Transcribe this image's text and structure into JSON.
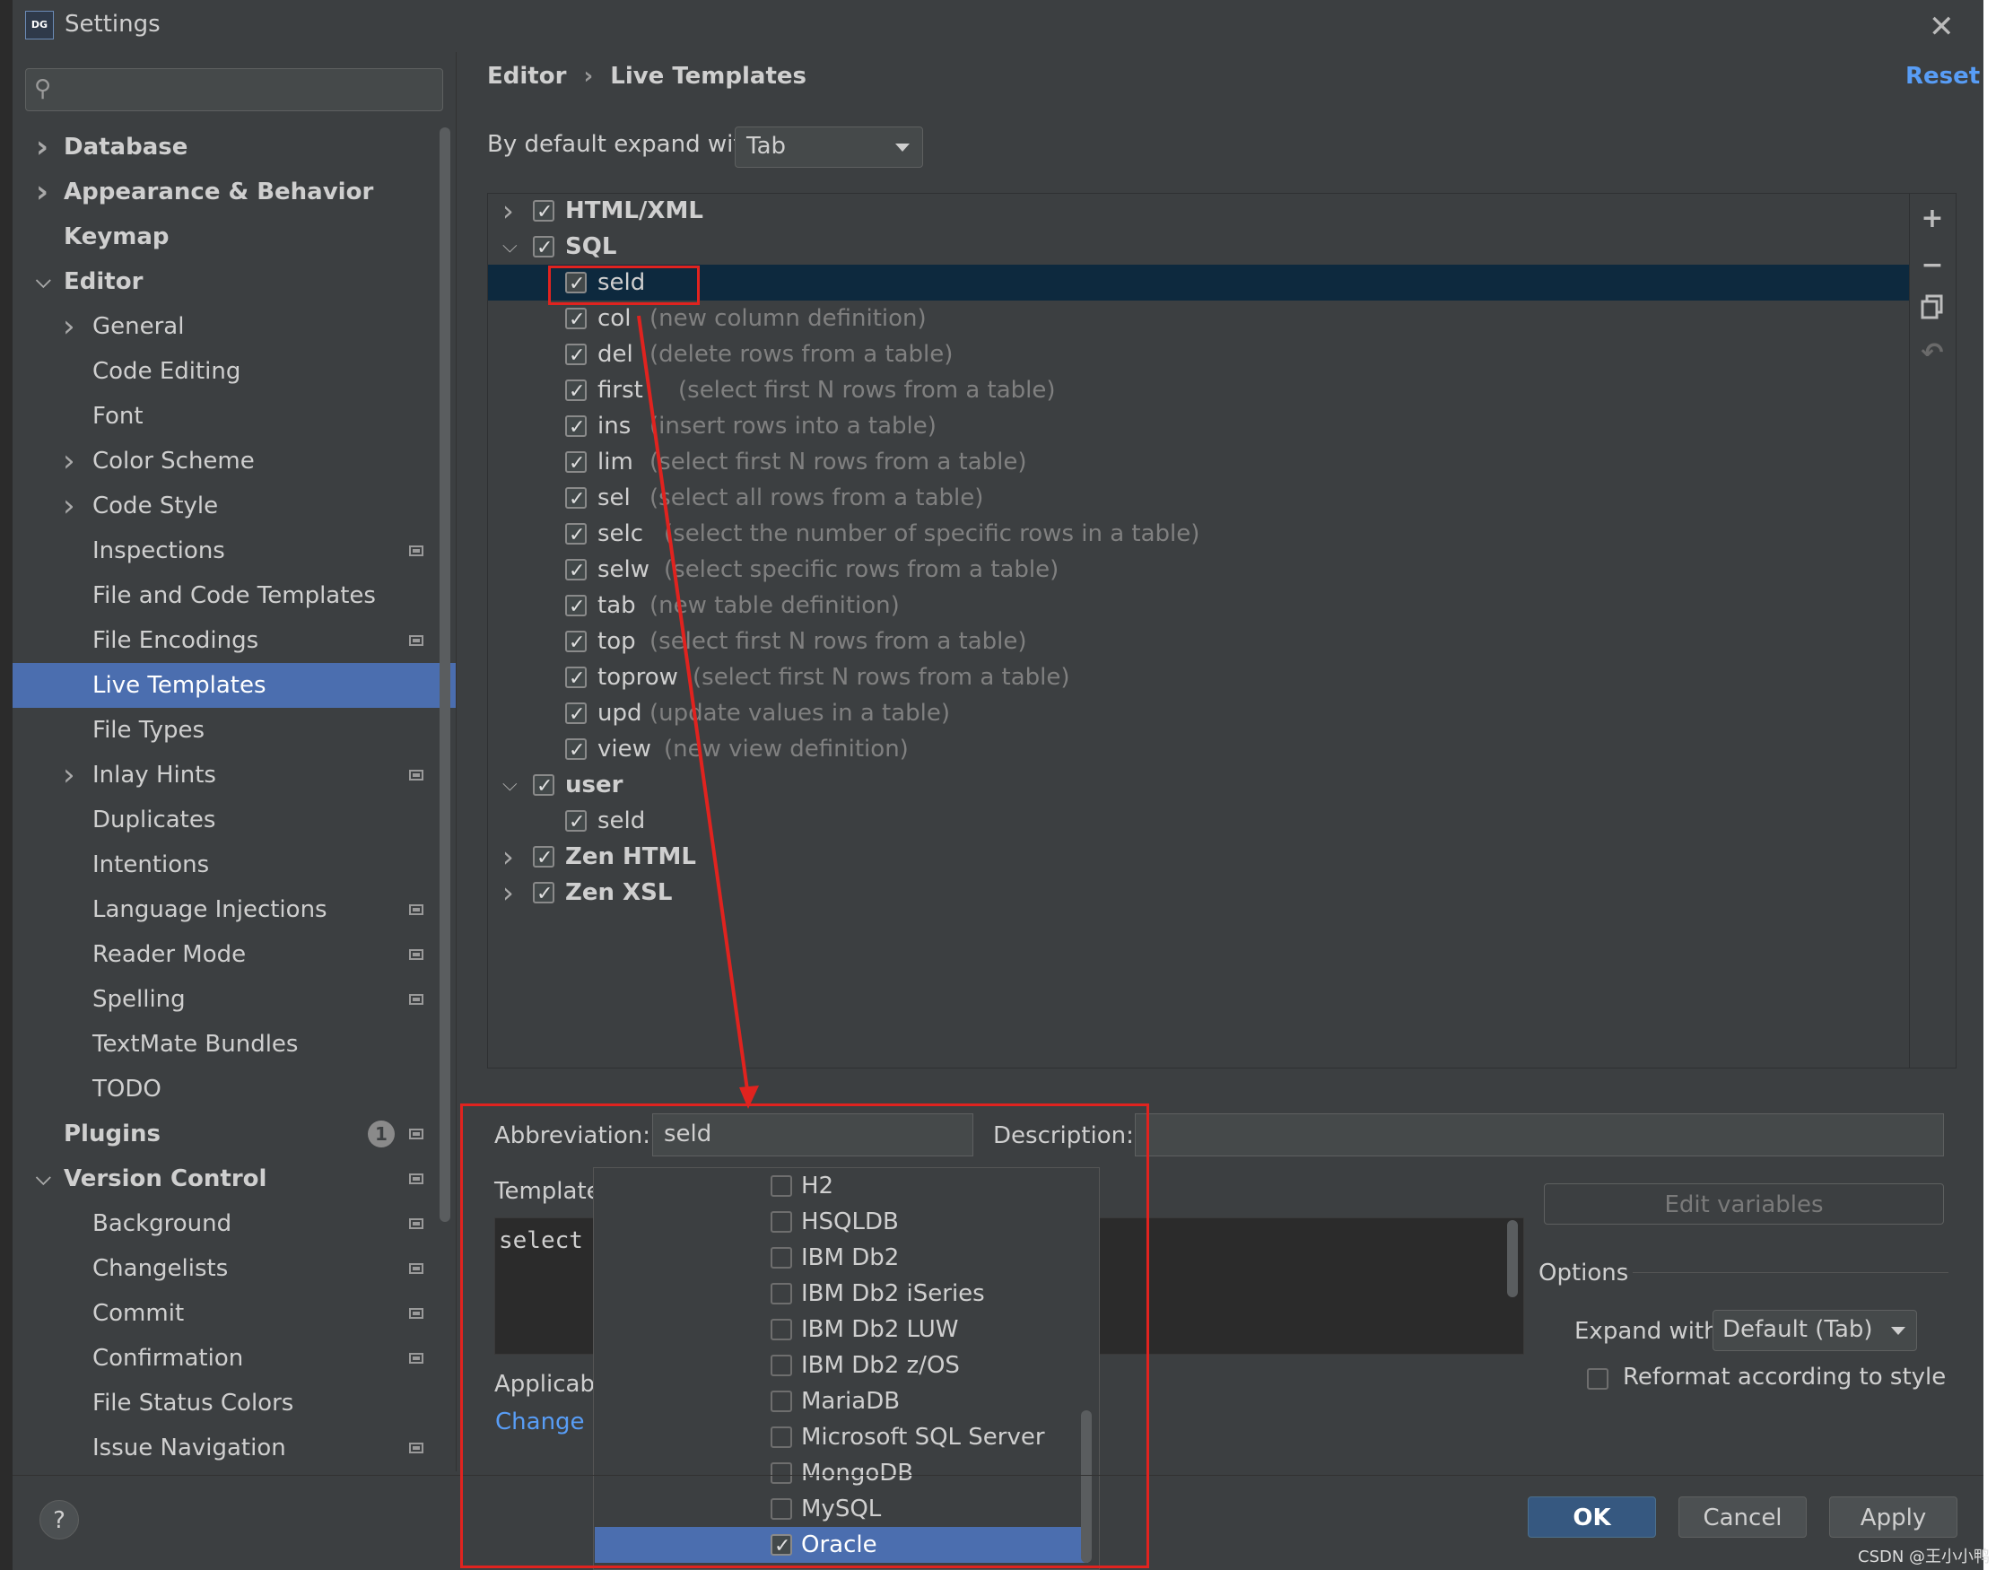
{
  "window": {
    "title": "Settings",
    "app_icon": "DG"
  },
  "search": {
    "placeholder": ""
  },
  "sidebar": [
    {
      "label": "Database",
      "bold": true,
      "chevron": "right",
      "indent": 0
    },
    {
      "label": "Appearance & Behavior",
      "bold": true,
      "chevron": "right",
      "indent": 0
    },
    {
      "label": "Keymap",
      "bold": true,
      "chevron": "",
      "indent": 0
    },
    {
      "label": "Editor",
      "bold": true,
      "chevron": "down",
      "indent": 0
    },
    {
      "label": "General",
      "bold": false,
      "chevron": "right",
      "indent": 1
    },
    {
      "label": "Code Editing",
      "bold": false,
      "chevron": "",
      "indent": 1
    },
    {
      "label": "Font",
      "bold": false,
      "chevron": "",
      "indent": 1
    },
    {
      "label": "Color Scheme",
      "bold": false,
      "chevron": "right",
      "indent": 1
    },
    {
      "label": "Code Style",
      "bold": false,
      "chevron": "right",
      "indent": 1
    },
    {
      "label": "Inspections",
      "bold": false,
      "chevron": "",
      "indent": 1,
      "icon": "project-scope-icon"
    },
    {
      "label": "File and Code Templates",
      "bold": false,
      "chevron": "",
      "indent": 1
    },
    {
      "label": "File Encodings",
      "bold": false,
      "chevron": "",
      "indent": 1,
      "icon": "project-scope-icon"
    },
    {
      "label": "Live Templates",
      "bold": false,
      "chevron": "",
      "indent": 1,
      "selected": true
    },
    {
      "label": "File Types",
      "bold": false,
      "chevron": "",
      "indent": 1
    },
    {
      "label": "Inlay Hints",
      "bold": false,
      "chevron": "right",
      "indent": 1,
      "icon": "project-scope-icon"
    },
    {
      "label": "Duplicates",
      "bold": false,
      "chevron": "",
      "indent": 1
    },
    {
      "label": "Intentions",
      "bold": false,
      "chevron": "",
      "indent": 1
    },
    {
      "label": "Language Injections",
      "bold": false,
      "chevron": "",
      "indent": 1,
      "icon": "project-scope-icon"
    },
    {
      "label": "Reader Mode",
      "bold": false,
      "chevron": "",
      "indent": 1,
      "icon": "project-scope-icon"
    },
    {
      "label": "Spelling",
      "bold": false,
      "chevron": "",
      "indent": 1,
      "icon": "project-scope-icon"
    },
    {
      "label": "TextMate Bundles",
      "bold": false,
      "chevron": "",
      "indent": 1
    },
    {
      "label": "TODO",
      "bold": false,
      "chevron": "",
      "indent": 1
    },
    {
      "label": "Plugins",
      "bold": true,
      "chevron": "",
      "indent": 0,
      "badge": "1",
      "icon": "project-scope-icon"
    },
    {
      "label": "Version Control",
      "bold": true,
      "chevron": "down",
      "indent": 0,
      "icon": "project-scope-icon"
    },
    {
      "label": "Background",
      "bold": false,
      "chevron": "",
      "indent": 1,
      "icon": "project-scope-icon"
    },
    {
      "label": "Changelists",
      "bold": false,
      "chevron": "",
      "indent": 1,
      "icon": "project-scope-icon"
    },
    {
      "label": "Commit",
      "bold": false,
      "chevron": "",
      "indent": 1,
      "icon": "project-scope-icon"
    },
    {
      "label": "Confirmation",
      "bold": false,
      "chevron": "",
      "indent": 1,
      "icon": "project-scope-icon"
    },
    {
      "label": "File Status Colors",
      "bold": false,
      "chevron": "",
      "indent": 1
    },
    {
      "label": "Issue Navigation",
      "bold": false,
      "chevron": "",
      "indent": 1,
      "icon": "project-scope-icon"
    }
  ],
  "breadcrumb": {
    "parent": "Editor",
    "separator": "›",
    "current": "Live Templates"
  },
  "reset_label": "Reset",
  "expand_default": {
    "label": "By default expand with",
    "value": "Tab"
  },
  "templates": [
    {
      "kind": "group",
      "name": "HTML/XML",
      "expanded": false,
      "checked": true
    },
    {
      "kind": "group",
      "name": "SQL",
      "expanded": true,
      "checked": true
    },
    {
      "kind": "item",
      "name": "seld",
      "desc": "",
      "checked": true,
      "selected": true
    },
    {
      "kind": "item",
      "name": "col",
      "desc": "(new column definition)",
      "checked": true
    },
    {
      "kind": "item",
      "name": "del",
      "desc": "(delete rows from a table)",
      "checked": true
    },
    {
      "kind": "item",
      "name": "first",
      "desc": "(select first N rows from a table)",
      "checked": true
    },
    {
      "kind": "item",
      "name": "ins",
      "desc": "(insert rows into a table)",
      "checked": true
    },
    {
      "kind": "item",
      "name": "lim",
      "desc": "(select first N rows from a table)",
      "checked": true
    },
    {
      "kind": "item",
      "name": "sel",
      "desc": "(select all rows from a table)",
      "checked": true
    },
    {
      "kind": "item",
      "name": "selc",
      "desc": "(select the number of specific rows in a table)",
      "checked": true
    },
    {
      "kind": "item",
      "name": "selw",
      "desc": "(select specific rows from a table)",
      "checked": true
    },
    {
      "kind": "item",
      "name": "tab",
      "desc": "(new table definition)",
      "checked": true
    },
    {
      "kind": "item",
      "name": "top",
      "desc": "(select first N rows from a table)",
      "checked": true
    },
    {
      "kind": "item",
      "name": "toprow",
      "desc": "(select first N rows from a table)",
      "checked": true
    },
    {
      "kind": "item",
      "name": "upd",
      "desc": "(update values in a table)",
      "checked": true
    },
    {
      "kind": "item",
      "name": "view",
      "desc": "(new view definition)",
      "checked": true
    },
    {
      "kind": "group",
      "name": "user",
      "expanded": true,
      "checked": true
    },
    {
      "kind": "item",
      "name": "seld",
      "desc": "",
      "checked": true
    },
    {
      "kind": "group",
      "name": "Zen HTML",
      "expanded": false,
      "checked": true
    },
    {
      "kind": "group",
      "name": "Zen XSL",
      "expanded": false,
      "checked": true
    }
  ],
  "toolbar": {
    "add": "+",
    "remove": "−",
    "copy_icon": "copy-icon",
    "restore_icon": "restore-icon"
  },
  "editor": {
    "abbreviation_label": "Abbreviation:",
    "abbreviation_value": "seld",
    "description_label": "Description:",
    "description_value": "",
    "template_label": "Template",
    "template_text": "select",
    "applicable_label": "Applicabl",
    "change_label": "Change ˅",
    "edit_variables": "Edit variables",
    "options_label": "Options",
    "expand_with_label": "Expand with",
    "expand_with_value": "Default (Tab)",
    "reformat_label": "Reformat according to style",
    "reformat_checked": false
  },
  "contexts_popup": [
    {
      "label": "H2",
      "checked": false
    },
    {
      "label": "HSQLDB",
      "checked": false
    },
    {
      "label": "IBM Db2",
      "checked": false
    },
    {
      "label": "IBM Db2 iSeries",
      "checked": false
    },
    {
      "label": "IBM Db2 LUW",
      "checked": false
    },
    {
      "label": "IBM Db2 z/OS",
      "checked": false
    },
    {
      "label": "MariaDB",
      "checked": false
    },
    {
      "label": "Microsoft SQL Server",
      "checked": false
    },
    {
      "label": "MongoDB",
      "checked": false
    },
    {
      "label": "MySQL",
      "checked": false
    },
    {
      "label": "Oracle",
      "checked": true,
      "selected": true
    }
  ],
  "buttons": {
    "ok": "OK",
    "cancel": "Cancel",
    "apply": "Apply",
    "help": "?"
  },
  "watermark": "CSDN @王小小鸭",
  "colors": {
    "accent": "#4b6eaf",
    "link": "#589df6",
    "annotation": "#e0231f",
    "selection_dark": "#0d293e"
  }
}
